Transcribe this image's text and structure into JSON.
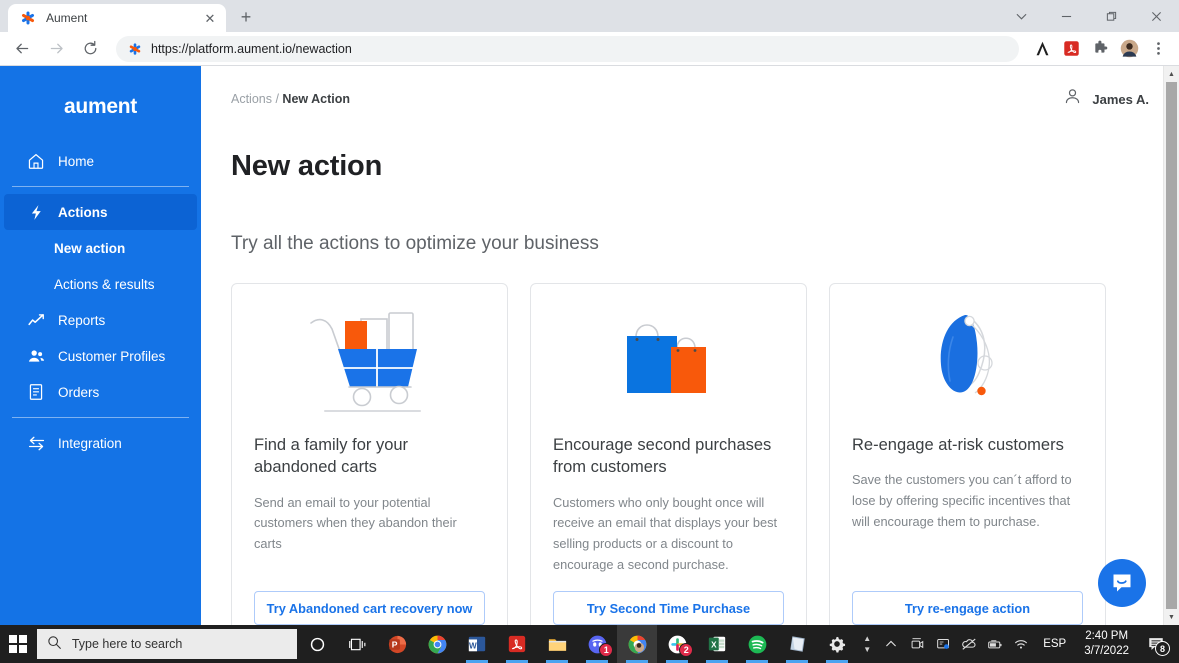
{
  "browser": {
    "tab": {
      "title": "Aument",
      "favicon_icon": "aument-asterisk-icon",
      "close_icon": "close-icon"
    },
    "new_tab_label": "+",
    "window_controls": [
      {
        "name": "tab-search-button",
        "glyph": "⌄"
      },
      {
        "name": "minimize-button",
        "glyph": "–"
      },
      {
        "name": "maximize-button",
        "glyph": "❐"
      },
      {
        "name": "close-window-button",
        "glyph": "✕"
      }
    ],
    "nav": {
      "back_icon": "back-arrow-icon",
      "forward_icon": "forward-arrow-icon",
      "reload_icon": "reload-icon"
    },
    "omnibox": {
      "url": "https://platform.aument.io/newaction",
      "favicon_icon": "aument-asterisk-icon"
    },
    "toolbar_icons": [
      {
        "name": "adobe-acrobat-extension-icon"
      },
      {
        "name": "pdf-extension-icon"
      },
      {
        "name": "extensions-puzzle-icon"
      },
      {
        "name": "profile-avatar-icon"
      },
      {
        "name": "chrome-menu-icon"
      }
    ]
  },
  "sidebar": {
    "logo": "aument",
    "items": [
      {
        "label": "Home",
        "icon": "home-icon",
        "active": false
      },
      {
        "label": "Actions",
        "icon": "lightning-bolt-icon",
        "active": true
      },
      {
        "label": "Reports",
        "icon": "chart-line-icon",
        "active": false
      },
      {
        "label": "Customer Profiles",
        "icon": "people-icon",
        "active": false
      },
      {
        "label": "Orders",
        "icon": "document-list-icon",
        "active": false
      },
      {
        "label": "Integration",
        "icon": "exchange-arrows-icon",
        "active": false
      }
    ],
    "sub_items": [
      {
        "label": "New action",
        "current": true
      },
      {
        "label": "Actions & results",
        "current": false
      }
    ]
  },
  "header": {
    "breadcrumb_parent": "Actions /",
    "breadcrumb_current": "New Action",
    "user_name": "James A.",
    "user_icon": "person-outline-icon"
  },
  "main": {
    "page_title": "New action",
    "section_title": "Try all the actions to optimize your business",
    "cards": [
      {
        "art": "shopping-cart-illustration",
        "title": "Find a family for your abandoned carts",
        "description": "Send an email to your potential customers when they abandon their carts",
        "button": "Try Abandoned cart recovery now"
      },
      {
        "art": "shopping-bags-illustration",
        "title": "Encourage second purchases from customers",
        "description": "Customers who only bought once will receive an email that displays your best selling products or a discount to encourage a second purchase.",
        "button": "Try Second Time Purchase"
      },
      {
        "art": "balloon-illustration",
        "title": "Re-engage at-risk customers",
        "description": "Save the customers you can´t afford to lose by offering specific incentives that will encourage them to purchase.",
        "button": "Try re-engage action"
      }
    ],
    "chat_launcher_icon": "intercom-chat-icon"
  },
  "colors": {
    "brand_blue": "#1473e6",
    "active_blue": "#0c63d4",
    "link_blue": "#1a73e8",
    "accent_orange": "#f8590b",
    "muted_text": "#80868b"
  },
  "taskbar": {
    "start_icon": "windows-start-icon",
    "search": {
      "placeholder": "Type here to search",
      "icon": "search-icon"
    },
    "pinned": [
      {
        "name": "cortana-icon",
        "running": false
      },
      {
        "name": "task-view-icon",
        "running": false
      },
      {
        "name": "powerpoint-icon",
        "running": false
      },
      {
        "name": "chrome-icon",
        "running": false
      },
      {
        "name": "word-icon",
        "running": true
      },
      {
        "name": "acrobat-reader-icon",
        "running": true
      },
      {
        "name": "file-explorer-icon",
        "running": true
      },
      {
        "name": "discord-icon",
        "running": true,
        "badge": "1"
      },
      {
        "name": "chrome-active-icon",
        "running": true,
        "active": true
      },
      {
        "name": "slack-icon",
        "running": true,
        "badge": "2"
      },
      {
        "name": "excel-icon",
        "running": true
      },
      {
        "name": "spotify-icon",
        "running": true
      },
      {
        "name": "sticky-notes-icon",
        "running": true
      },
      {
        "name": "settings-gear-icon",
        "running": true
      }
    ],
    "tray": {
      "overflow_icon": "show-hidden-icons-icon",
      "icons": [
        {
          "name": "screen-recorder-icon"
        },
        {
          "name": "remote-display-icon"
        },
        {
          "name": "onedrive-paused-icon"
        },
        {
          "name": "battery-icon"
        },
        {
          "name": "wifi-icon"
        }
      ],
      "language": "ESP",
      "time": "2:40 PM",
      "date": "3/7/2022",
      "notification_icon": "notifications-icon",
      "notification_count": "8"
    }
  }
}
